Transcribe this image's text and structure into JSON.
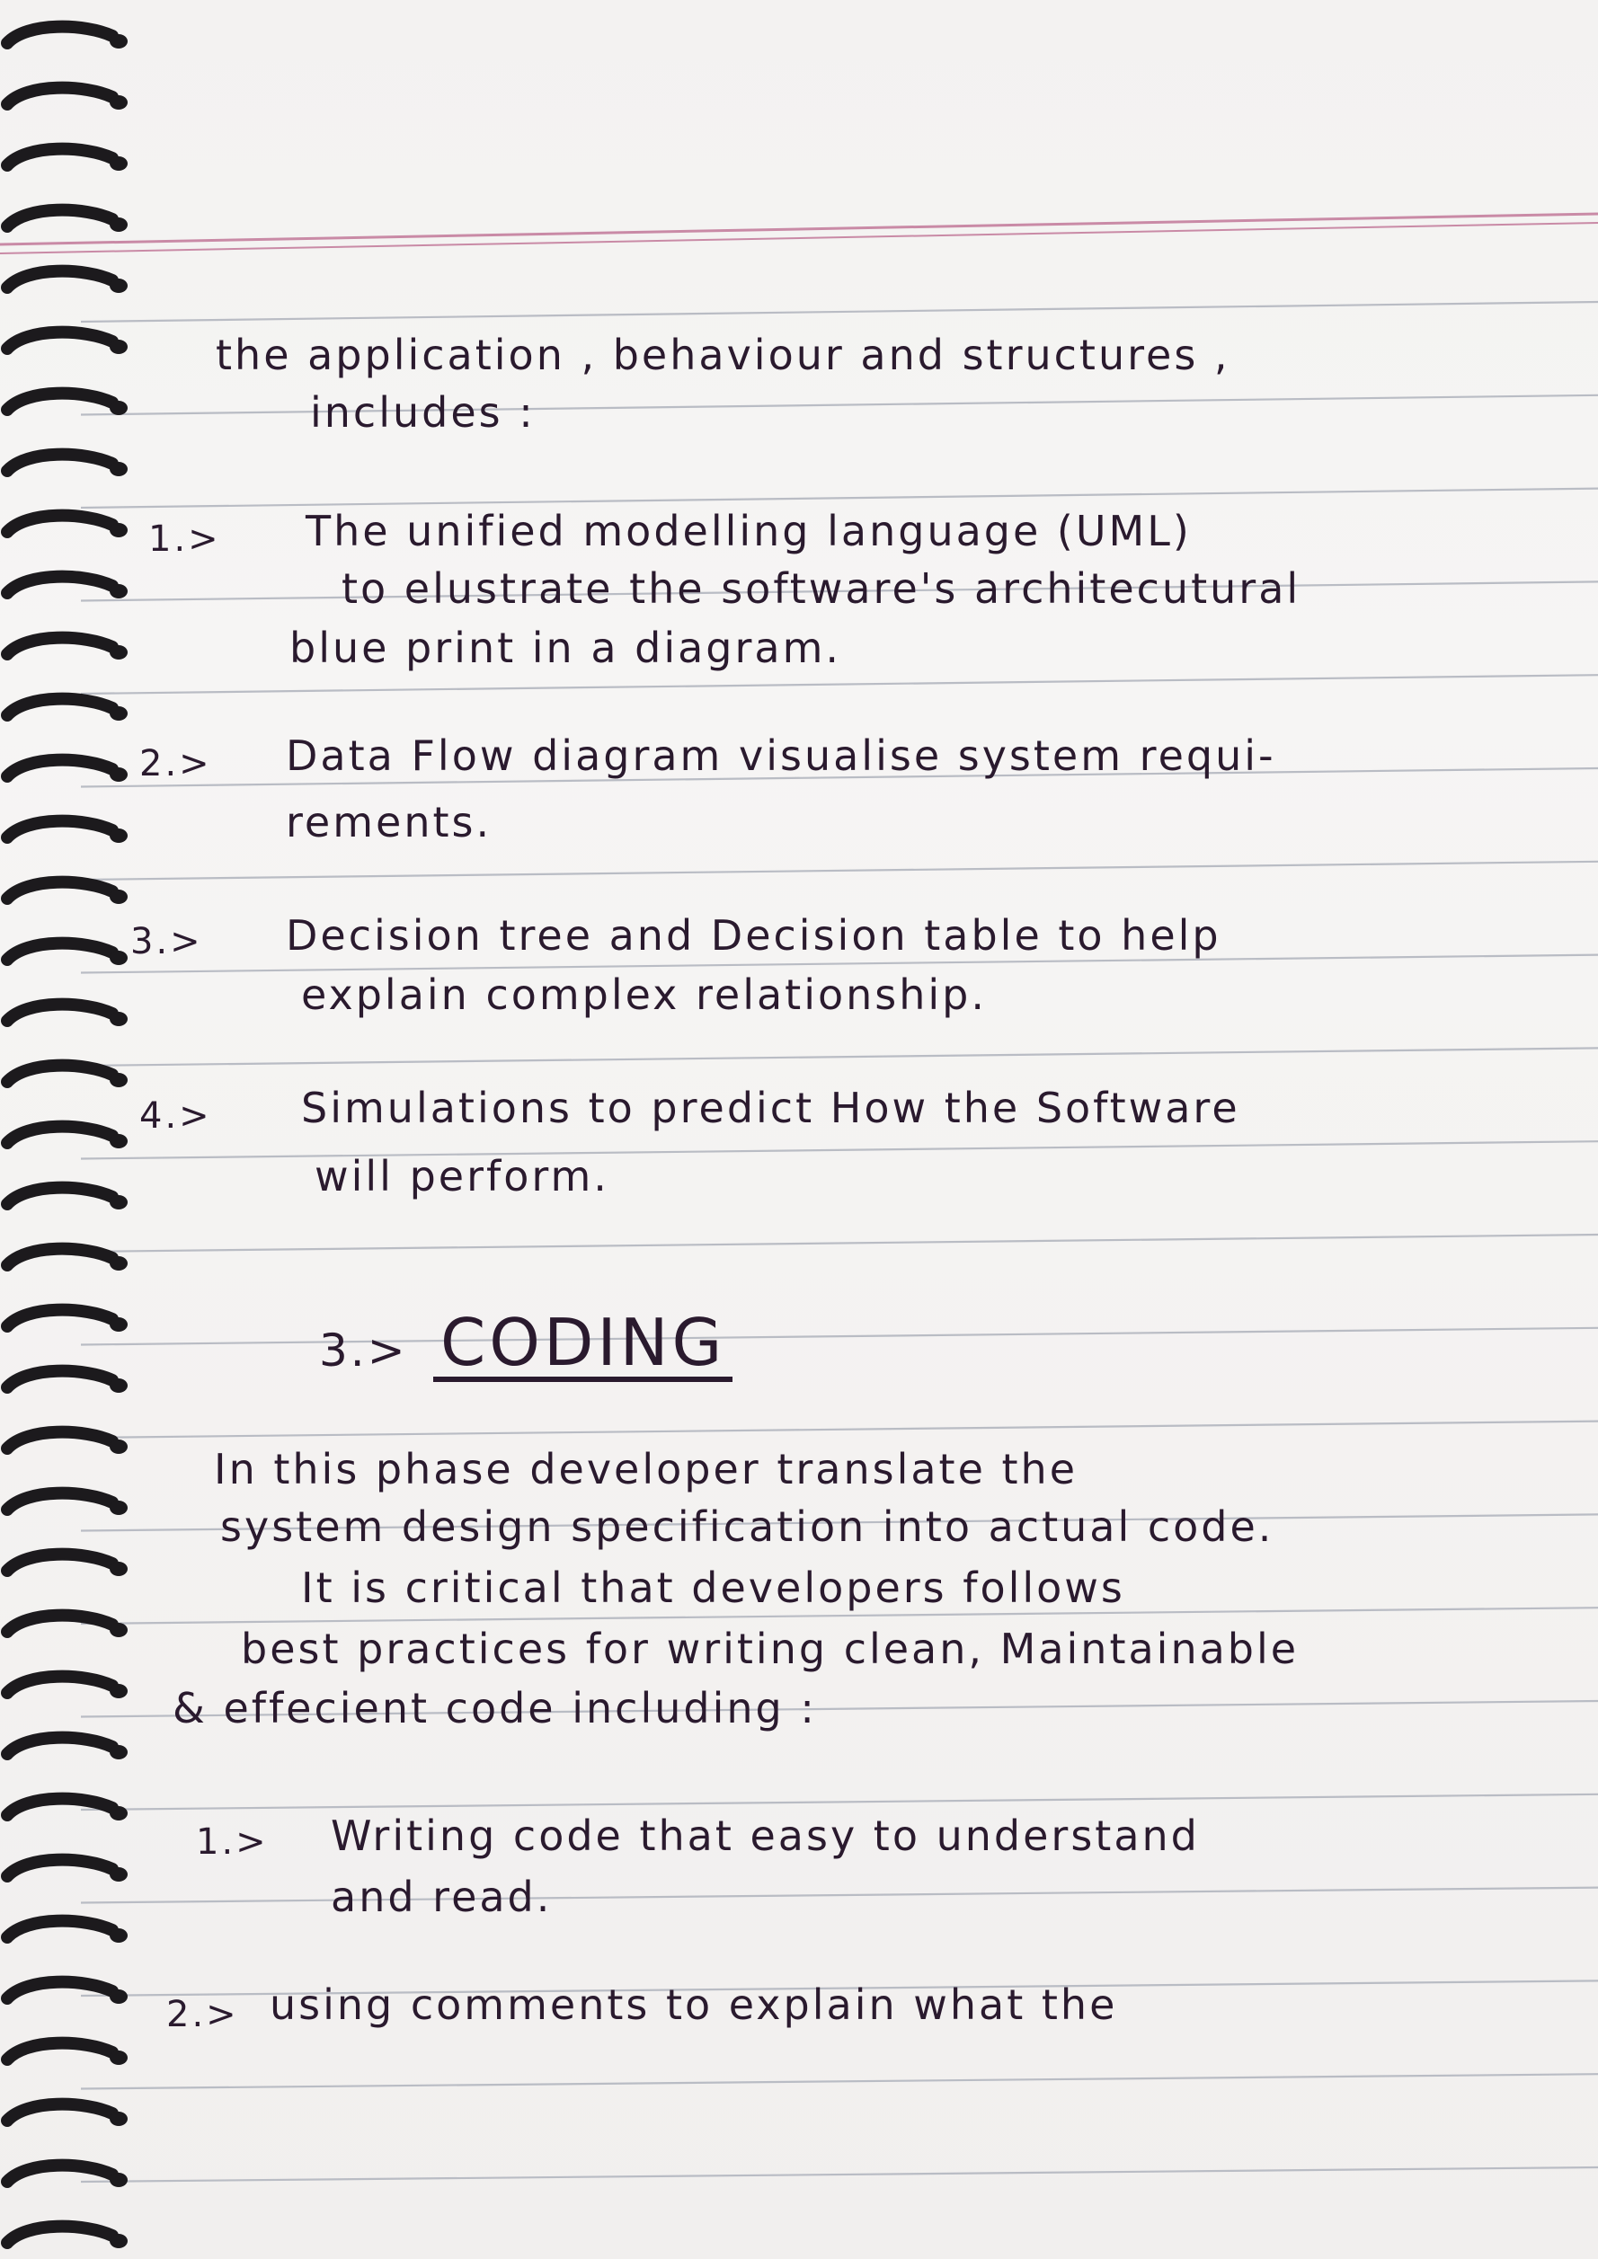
{
  "page": {
    "intro": {
      "line1": "the application , behaviour and structures ,",
      "line2": "includes :"
    },
    "list_a": [
      {
        "num": "1.>",
        "lines": [
          "The unified modelling language (UML)",
          "to elustrate the software's architecutural",
          "blue print in a diagram."
        ]
      },
      {
        "num": "2.>",
        "lines": [
          "Data Flow diagram visualise system requi-",
          "rements."
        ]
      },
      {
        "num": "3.>",
        "lines": [
          "Decision tree and Decision table to help",
          "explain complex relationship."
        ]
      },
      {
        "num": "4.>",
        "lines": [
          "Simulations to predict How the Software",
          "will perform."
        ]
      }
    ],
    "section": {
      "num": "3.>",
      "title": "CODING"
    },
    "paragraph": [
      "In this phase developer translate the",
      "system design specification into actual code.",
      "It is critical that developers follows",
      "best practices for writing clean, Maintainable",
      "& effecient code including :"
    ],
    "list_b": [
      {
        "num": "1.>",
        "lines": [
          "Writing code that easy to understand",
          "and read."
        ]
      },
      {
        "num": "2.>",
        "lines": [
          "using comments to explain what the"
        ]
      }
    ]
  },
  "colors": {
    "ink": "#2a1a2e",
    "rule": "#b9bcc4",
    "margin": "#c98aa6"
  }
}
